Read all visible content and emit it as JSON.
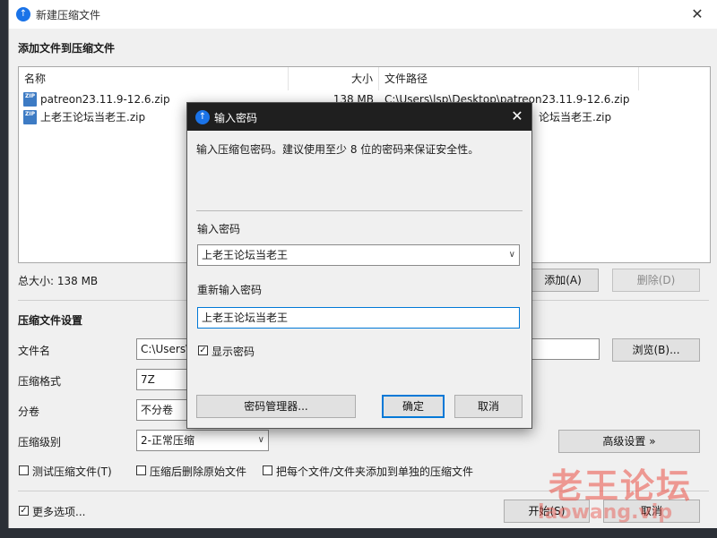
{
  "main_window": {
    "title": "新建压缩文件",
    "close_glyph": "✕",
    "section_add": "添加文件到压缩文件",
    "columns": [
      "名称",
      "大小",
      "文件路径"
    ],
    "files": [
      {
        "name": "patreon23.11.9-12.6.zip",
        "size": "138 MB",
        "path": "C:\\Users\\lsp\\Desktop\\patreon23.11.9-12.6.zip"
      },
      {
        "name": "上老王论坛当老王.zip",
        "size": "",
        "path": "论坛当老王.zip"
      }
    ],
    "total_size": "总大小: 138 MB",
    "add_button": "添加(A)",
    "delete_button": "删除(D)",
    "section_settings": "压缩文件设置",
    "filename_label": "文件名",
    "filename_value": "C:\\Users\\",
    "browse_button": "浏览(B)...",
    "format_label": "压缩格式",
    "format_value": "7Z",
    "split_label": "分卷",
    "split_value": "不分卷",
    "level_label": "压缩级别",
    "level_value": "2-正常压缩",
    "advanced_button": "高级设置 »",
    "test_checkbox": "测试压缩文件(T)",
    "delete_after_checkbox": "压缩后删除原始文件",
    "separate_checkbox": "把每个文件/文件夹添加到单独的压缩文件",
    "more_options": "更多选项...",
    "start_button": "开始(S)",
    "cancel_button": "取消"
  },
  "password_dialog": {
    "title": "输入密码",
    "close_glyph": "✕",
    "description": "输入压缩包密码。建议使用至少 8 位的密码来保证安全性。",
    "password_label": "输入密码",
    "password_value": "上老王论坛当老王",
    "confirm_label": "重新输入密码",
    "confirm_value": "上老王论坛当老王",
    "show_password": "显示密码",
    "show_password_checked": true,
    "manager_button": "密码管理器...",
    "ok_button": "确定",
    "cancel_button": "取消"
  },
  "watermark": {
    "text": "老王论坛",
    "url_fragment": "laowang.vip"
  },
  "colors": {
    "accent": "#0078d7",
    "app_icon": "#1a73e8",
    "dialog_title_bar": "#1f1f1f",
    "watermark": "#eb5046"
  }
}
